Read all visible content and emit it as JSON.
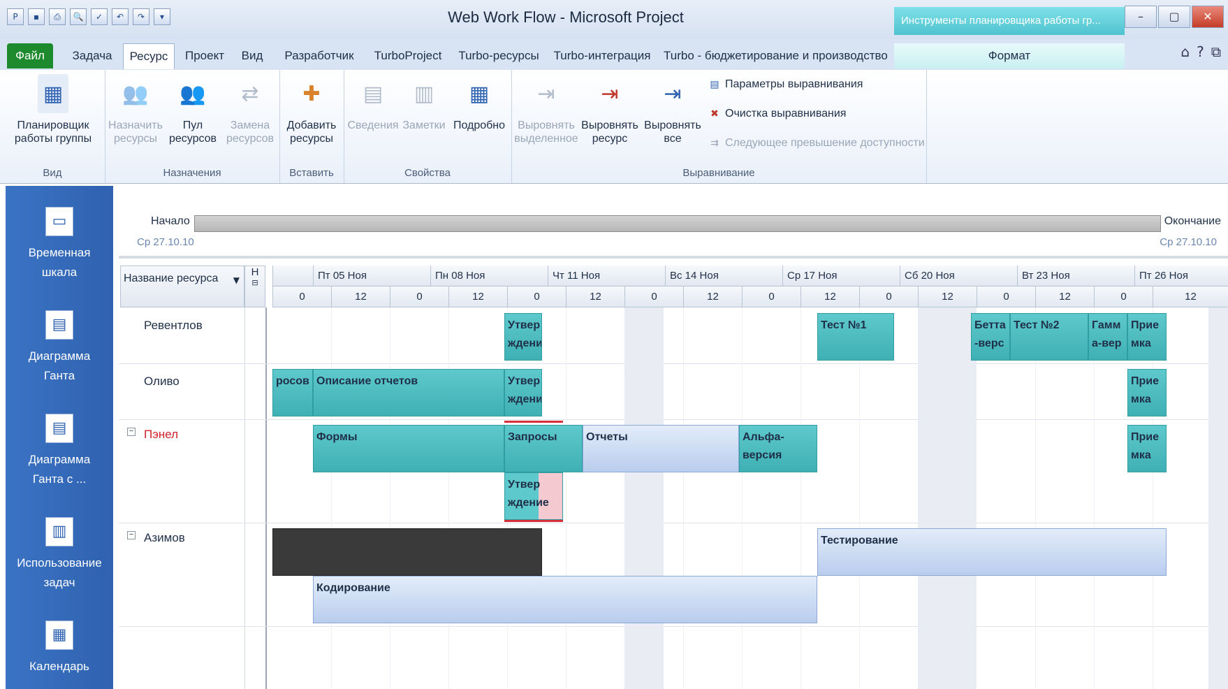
{
  "window": {
    "title": "Web Work Flow - Microsoft Project",
    "context_header": "Инструменты планировщика работы гр..."
  },
  "tabs": [
    "Файл",
    "Задача",
    "Ресурс",
    "Проект",
    "Вид",
    "Разработчик",
    "TurboProject",
    "Turbo-ресурсы",
    "Turbo-интеграция",
    "Turbo - бюджетирование и производство",
    "Формат"
  ],
  "ribbon": {
    "view": {
      "btn1": "Планировщик",
      "btn2": "работы группы",
      "label": "Вид"
    },
    "assign": {
      "assign1": "Назначить",
      "assign2": "ресурсы",
      "pool1": "Пул",
      "pool2": "ресурсов",
      "replace1": "Замена",
      "replace2": "ресурсов",
      "label": "Назначения"
    },
    "insert": {
      "add1": "Добавить",
      "add2": "ресурсы",
      "label": "Вставить"
    },
    "props": {
      "info": "Сведения",
      "notes": "Заметки",
      "details": "Подробно",
      "label": "Свойства"
    },
    "level": {
      "sel1": "Выровнять",
      "sel2": "выделенное",
      "res1": "Выровнять",
      "res2": "ресурс",
      "all1": "Выровнять",
      "all2": "все",
      "params": "Параметры выравнивания",
      "clear": "Очистка выравнивания",
      "next": "Следующее превышение доступности",
      "label": "Выравнивание"
    }
  },
  "viewbar": {
    "items": [
      {
        "l1": "Временная",
        "l2": "шкала"
      },
      {
        "l1": "Диаграмма",
        "l2": "Ганта"
      },
      {
        "l1": "Диаграмма",
        "l2": "Ганта с ..."
      },
      {
        "l1": "Использование",
        "l2": "задач"
      },
      {
        "l1": "Календарь",
        "l2": ""
      }
    ]
  },
  "timeline": {
    "start_label": "Начало",
    "start_date": "Ср 27.10.10",
    "end_label": "Окончание",
    "end_date": "Ср 27.10.10"
  },
  "grid": {
    "col_name": "Название ресурса",
    "col_n": "Н",
    "days": [
      "Пт 05 Ноя",
      "Пн 08 Ноя",
      "Чт 11 Ноя",
      "Вс 14 Ноя",
      "Ср 17 Ноя",
      "Сб 20 Ноя",
      "Вт 23 Ноя",
      "Пт 26 Ноя"
    ],
    "hours": [
      "0",
      "12",
      "0",
      "12",
      "0",
      "12",
      "0",
      "12",
      "0",
      "12",
      "0",
      "12",
      "0",
      "12",
      "0",
      "12"
    ],
    "resources": [
      "Ревентлов",
      "Оливо",
      "Пэнел",
      "Азимов"
    ],
    "tasks": {
      "t1": "Утвер ждение",
      "t2": "Тест №1",
      "t3": "Бетта -верс",
      "t4": "Тест №2",
      "t5": "Гамм а-вер",
      "t6": "Прие мка",
      "t7": "росов",
      "t8": "Описание отчетов",
      "t9": "Утвер ждение",
      "t10": "Прие мка",
      "t11": "Формы",
      "t12": "Запросы",
      "t13": "Отчеты",
      "t14": "Альфа- версия",
      "t15": "Прие мка",
      "t16": "Утвер ждение",
      "t17": "Тестирование",
      "t18": "Кодирование"
    }
  }
}
